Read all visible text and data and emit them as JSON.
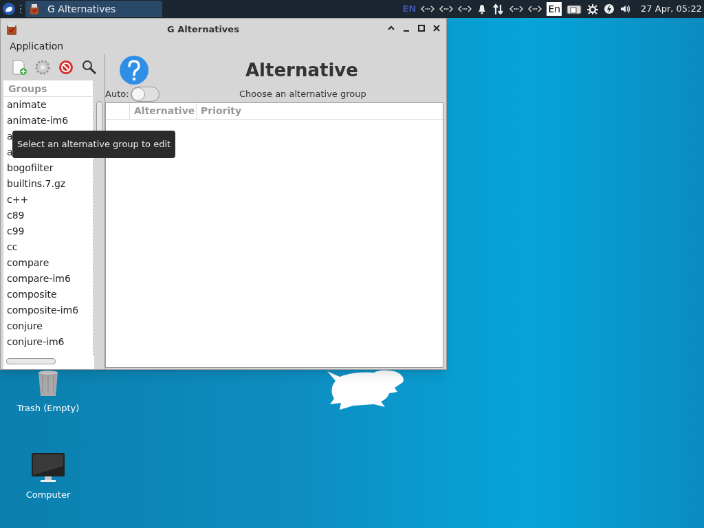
{
  "panel": {
    "task_button": {
      "label": "G Alternatives",
      "selected": true
    },
    "tray": [
      {
        "kind": "text",
        "label": "EN"
      },
      {
        "kind": "dots"
      },
      {
        "kind": "dots"
      },
      {
        "kind": "dots"
      },
      {
        "kind": "bell"
      },
      {
        "kind": "updown"
      },
      {
        "kind": "dots"
      },
      {
        "kind": "dots"
      },
      {
        "kind": "boxtext",
        "label": "En"
      },
      {
        "kind": "keyboard"
      },
      {
        "kind": "gear"
      },
      {
        "kind": "bolt"
      },
      {
        "kind": "volume"
      }
    ],
    "clock": "27 Apr, 05:22"
  },
  "window": {
    "title": "G Alternatives",
    "menu": [
      "Application"
    ],
    "groups": {
      "header": "Groups",
      "items": [
        "animate",
        "animate-im6",
        "a",
        "a",
        "bogofilter",
        "builtins.7.gz",
        "c++",
        "c89",
        "c99",
        "cc",
        "compare",
        "compare-im6",
        "composite",
        "composite-im6",
        "conjure",
        "conjure-im6"
      ]
    },
    "heading": "Alternative",
    "auto": {
      "label": "Auto:",
      "on": false
    },
    "subtitle": "Choose an alternative group",
    "table": {
      "columns": [
        "Alternative",
        "Priority"
      ]
    },
    "tooltip": "Select an alternative group to edit"
  },
  "desktop": {
    "icons": [
      {
        "kind": "trash",
        "label": "Trash (Empty)"
      },
      {
        "kind": "computer",
        "label": "Computer"
      }
    ]
  }
}
